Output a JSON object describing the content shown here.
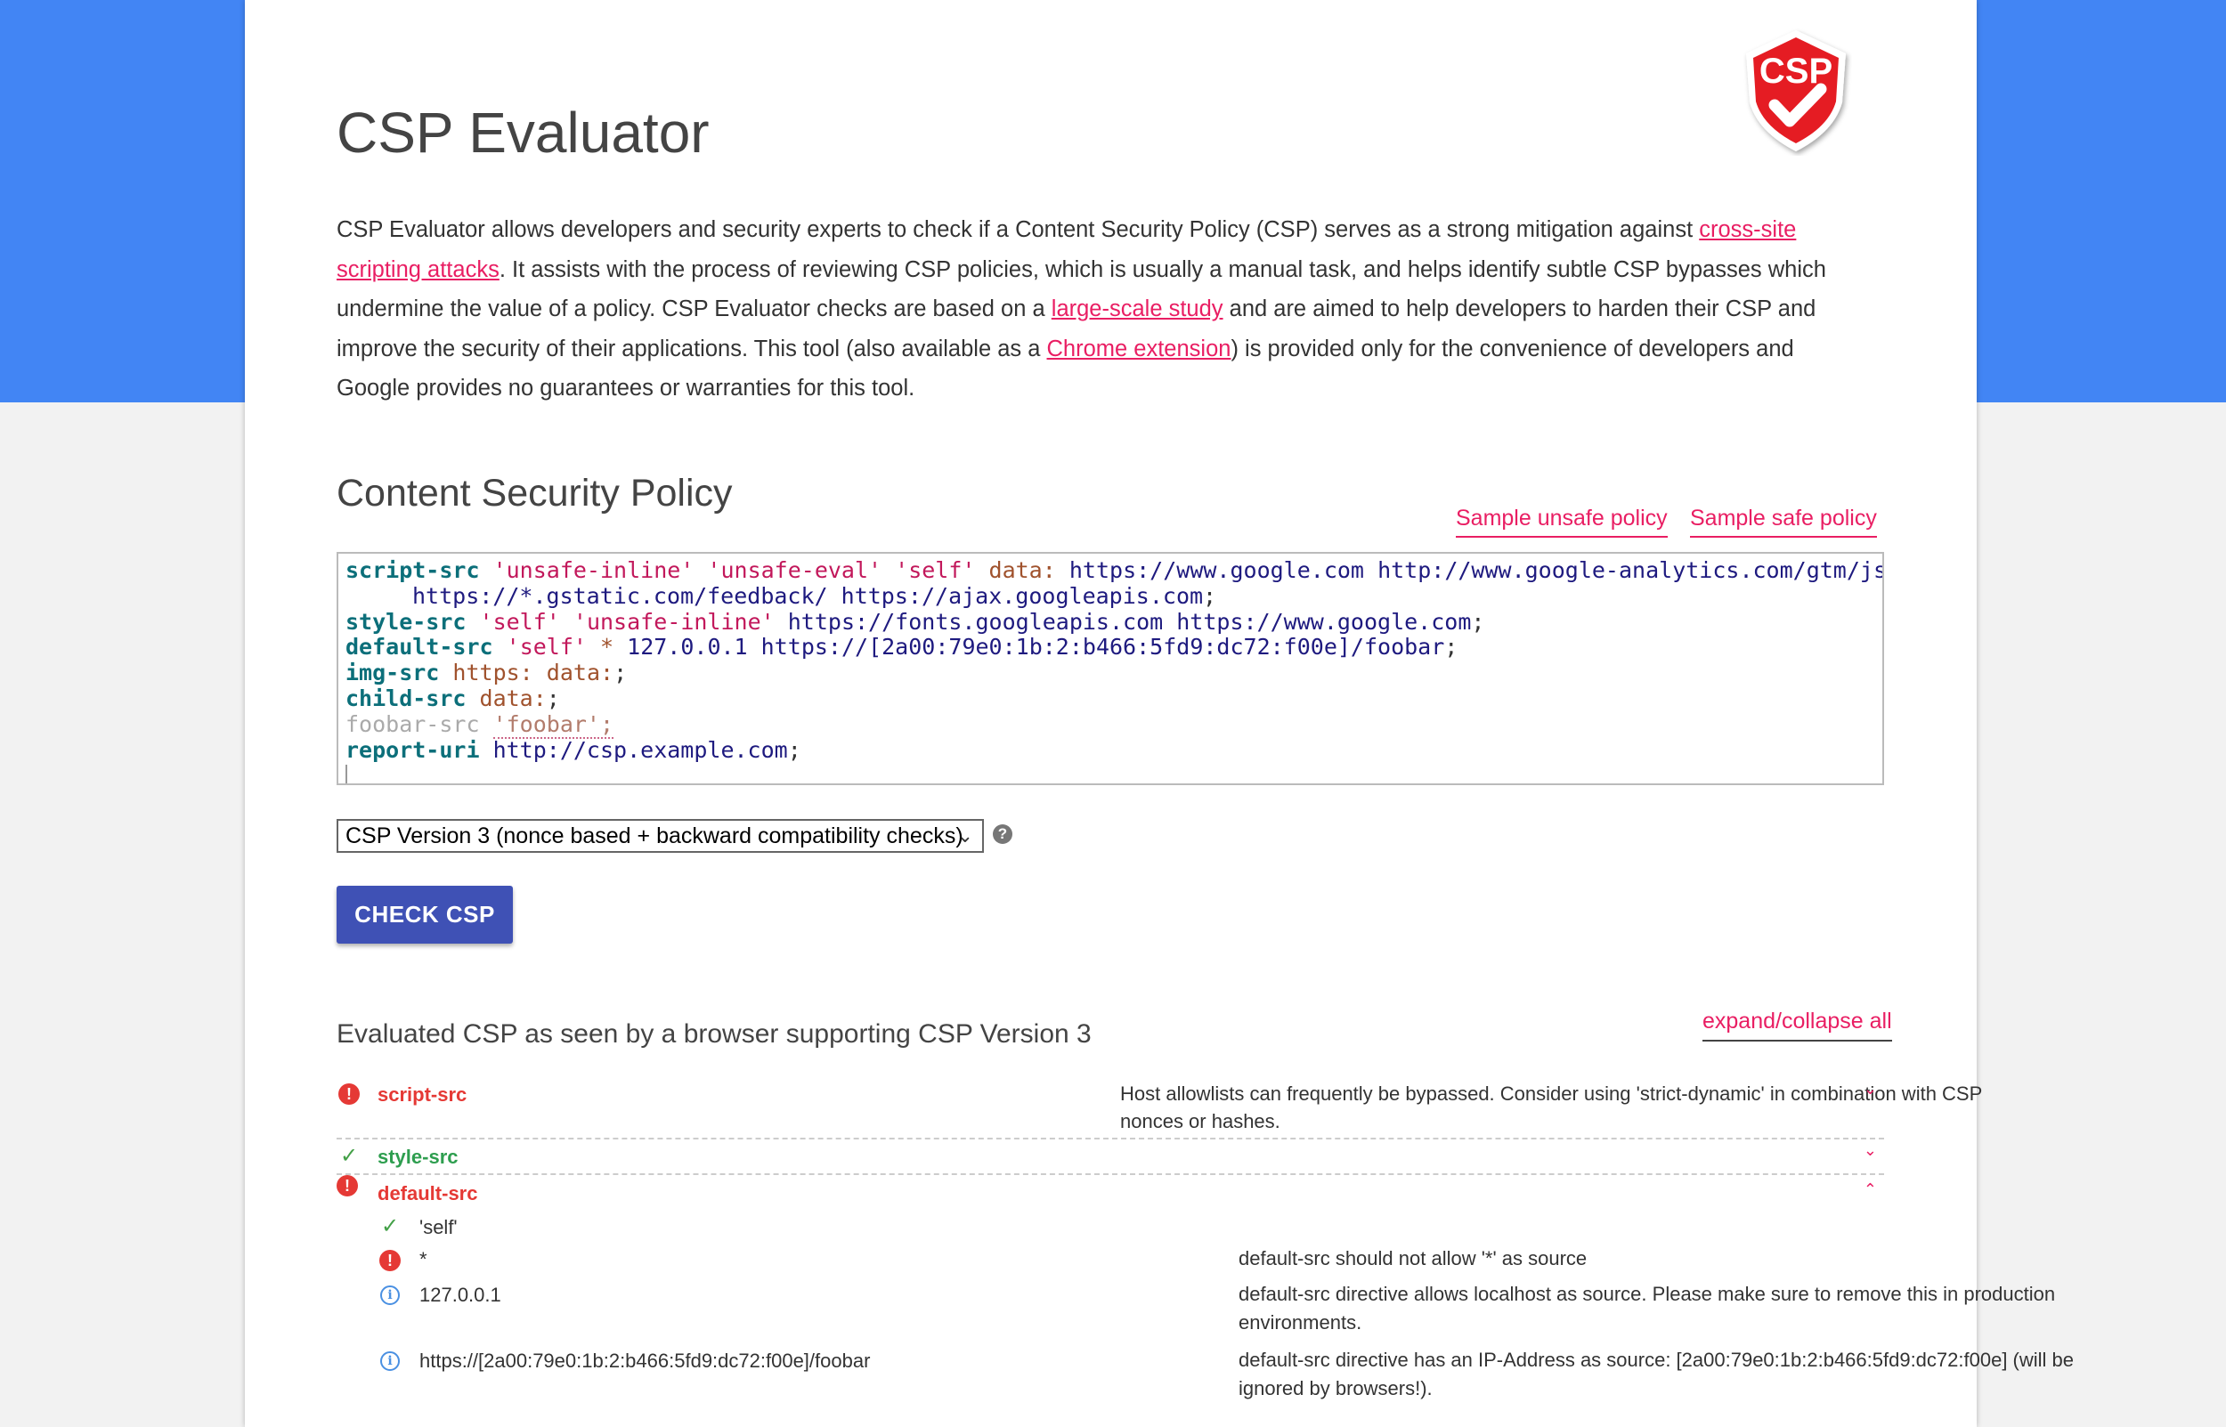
{
  "colors": {
    "header_blue": "#4285f4",
    "accent_pink": "#e91e63",
    "button_indigo": "#3f51b5",
    "error_red": "#e53935",
    "ok_green": "#43a047"
  },
  "logo": {
    "text": "CSP"
  },
  "page_title": "CSP Evaluator",
  "intro": {
    "t1": "CSP Evaluator allows developers and security experts to check if a Content Security Policy (CSP) serves as a strong mitigation against ",
    "link1": "cross-site scripting attacks",
    "t2": ". It assists with the process of reviewing CSP policies, which is usually a manual task, and helps identify subtle CSP bypasses which undermine the value of a policy. CSP Evaluator checks are based on a ",
    "link2": "large-scale study",
    "t3": " and are aimed to help developers to harden their CSP and improve the security of their applications. This tool (also available as a ",
    "link3": "Chrome extension",
    "t4": ") is provided only for the convenience of developers and Google provides no guarantees or warranties for this tool."
  },
  "policy_section": {
    "title": "Content Security Policy",
    "sample_unsafe": "Sample unsafe policy",
    "sample_safe": "Sample safe policy"
  },
  "editor": {
    "lines": [
      [
        [
          "kw",
          "script-src"
        ],
        [
          "sp",
          " "
        ],
        [
          "str",
          "'unsafe-inline'"
        ],
        [
          "sp",
          " "
        ],
        [
          "str",
          "'unsafe-eval'"
        ],
        [
          "sp",
          " "
        ],
        [
          "str",
          "'self'"
        ],
        [
          "sp",
          " "
        ],
        [
          "val",
          "data:"
        ],
        [
          "sp",
          " "
        ],
        [
          "url",
          "https://www.google.com"
        ],
        [
          "sp",
          " "
        ],
        [
          "url",
          "http://www.google-analytics.com/gtm/js"
        ]
      ],
      [
        [
          "url",
          "https://*.gstatic.com/feedback/"
        ],
        [
          "sp",
          " "
        ],
        [
          "url",
          "https://ajax.googleapis.com"
        ],
        [
          "sp",
          ";"
        ]
      ],
      [
        [
          "kw",
          "style-src"
        ],
        [
          "sp",
          " "
        ],
        [
          "str",
          "'self'"
        ],
        [
          "sp",
          " "
        ],
        [
          "str",
          "'unsafe-inline'"
        ],
        [
          "sp",
          " "
        ],
        [
          "url",
          "https://fonts.googleapis.com"
        ],
        [
          "sp",
          " "
        ],
        [
          "url",
          "https://www.google.com"
        ],
        [
          "sp",
          ";"
        ]
      ],
      [
        [
          "kw",
          "default-src"
        ],
        [
          "sp",
          " "
        ],
        [
          "str",
          "'self'"
        ],
        [
          "sp",
          " "
        ],
        [
          "val",
          "*"
        ],
        [
          "sp",
          " "
        ],
        [
          "url",
          "127.0.0.1"
        ],
        [
          "sp",
          " "
        ],
        [
          "url",
          "https://[2a00:79e0:1b:2:b466:5fd9:dc72:f00e]/foobar"
        ],
        [
          "sp",
          ";"
        ]
      ],
      [
        [
          "kw",
          "img-src"
        ],
        [
          "sp",
          " "
        ],
        [
          "val",
          "https:"
        ],
        [
          "sp",
          " "
        ],
        [
          "val",
          "data:"
        ],
        [
          "sp",
          ";"
        ]
      ],
      [
        [
          "kw",
          "child-src"
        ],
        [
          "sp",
          " "
        ],
        [
          "val",
          "data:"
        ],
        [
          "sp",
          ";"
        ]
      ],
      [
        [
          "unk",
          "foobar-src"
        ],
        [
          "sp",
          " "
        ],
        [
          "unkv",
          "'foobar';"
        ]
      ],
      [
        [
          "kw",
          "report-uri"
        ],
        [
          "sp",
          " "
        ],
        [
          "url",
          "http://csp.example.com"
        ],
        [
          "sp",
          ";"
        ]
      ]
    ]
  },
  "version_select": {
    "selected": "CSP Version 3 (nonce based + backward compatibility checks)",
    "help": "?"
  },
  "check_button": "CHECK CSP",
  "evaluation": {
    "title": "Evaluated CSP as seen by a browser supporting CSP Version 3",
    "expand_all": "expand/collapse all",
    "directives": [
      {
        "name": "script-src",
        "status": "error",
        "message": "Host allowlists can frequently be bypassed. Consider using 'strict-dynamic' in combination with CSP nonces or hashes.",
        "expanded": false
      },
      {
        "name": "style-src",
        "status": "ok",
        "message": "",
        "expanded": false
      },
      {
        "name": "default-src",
        "status": "error",
        "message": "",
        "expanded": true,
        "values": [
          {
            "value": "'self'",
            "status": "ok",
            "message": ""
          },
          {
            "value": "*",
            "status": "error",
            "message": "default-src should not allow '*' as source"
          },
          {
            "value": "127.0.0.1",
            "status": "info",
            "message": "default-src directive allows localhost as source. Please make sure to remove this in production environments."
          },
          {
            "value": "https://[2a00:79e0:1b:2:b466:5fd9:dc72:f00e]/foobar",
            "status": "info",
            "message": "default-src directive has an IP-Address as source: [2a00:79e0:1b:2:b466:5fd9:dc72:f00e] (will be ignored by browsers!)."
          }
        ]
      }
    ]
  }
}
